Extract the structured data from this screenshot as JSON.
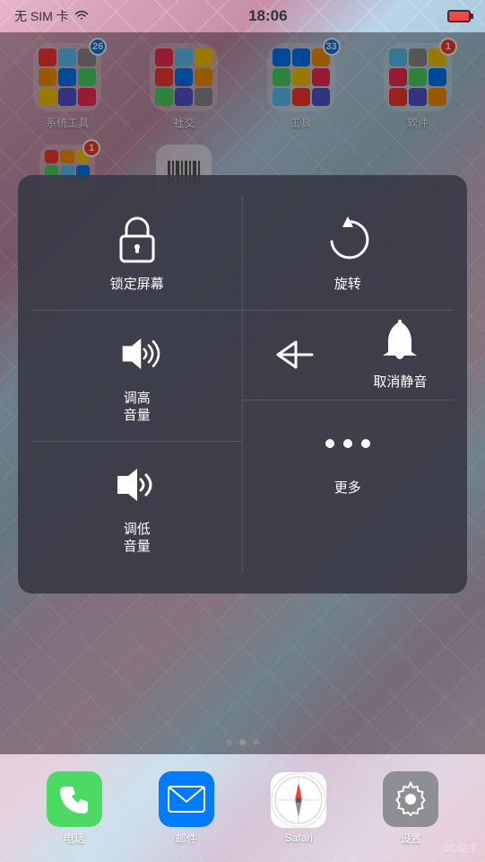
{
  "statusBar": {
    "carrier": "无 SIM 卡",
    "wifi": "wifi",
    "time": "18:06",
    "battery": "low"
  },
  "folders": [
    {
      "label": "系统工具",
      "badge": "26",
      "badgeColor": "blue"
    },
    {
      "label": "社交",
      "badge": "",
      "badgeColor": ""
    },
    {
      "label": "工具",
      "badge": "33",
      "badgeColor": "blue"
    },
    {
      "label": "软件",
      "badge": "1",
      "badgeColor": "red"
    }
  ],
  "secondRow": [
    {
      "label": "",
      "badge": "1",
      "badgeColor": "red"
    },
    {
      "label": "",
      "badge": "",
      "badgeColor": ""
    }
  ],
  "popup": {
    "topLeft": {
      "label": "锁定屏幕"
    },
    "topRight": {
      "label": "旋转"
    },
    "middleLeft": {
      "label": "调高\n音量"
    },
    "middleRight": {
      "label": "取消静音"
    },
    "bottomLeft": {
      "label": "调低\n音量"
    },
    "bottomRight": {
      "label": "更多"
    }
  },
  "pageDots": [
    {
      "active": false
    },
    {
      "active": true
    },
    {
      "active": false
    }
  ],
  "dock": [
    {
      "label": "电话",
      "type": "phone"
    },
    {
      "label": "邮件",
      "type": "mail"
    },
    {
      "label": "Safari",
      "type": "safari"
    },
    {
      "label": "设置",
      "type": "settings"
    }
  ],
  "watermark": "DD助手"
}
